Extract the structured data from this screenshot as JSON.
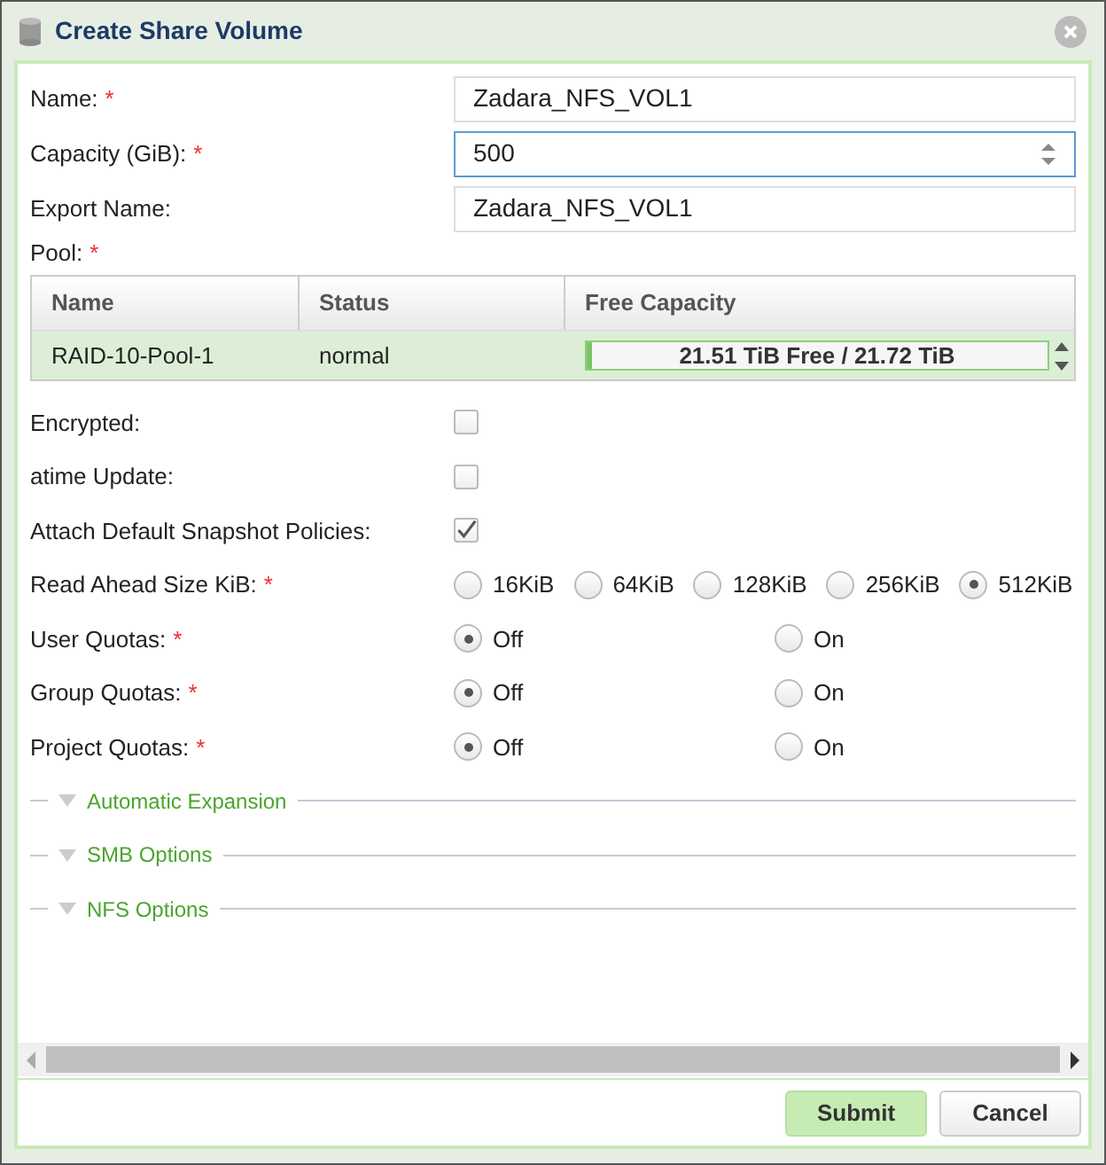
{
  "window": {
    "title": "Create Share Volume"
  },
  "fields": [
    {
      "label": "Name:",
      "required_mark": "*",
      "value": "Zadara_NFS_VOL1",
      "kind": "text",
      "focused": false
    },
    {
      "label": "Capacity (GiB):",
      "required_mark": "*",
      "value": "500",
      "kind": "number",
      "focused": true
    },
    {
      "label": "Export Name:",
      "value": "Zadara_NFS_VOL1",
      "kind": "text",
      "focused": false
    }
  ],
  "pool": {
    "label": "Pool:",
    "required_mark": "*",
    "columns": [
      "Name",
      "Status",
      "Free Capacity"
    ],
    "rows": [
      {
        "name": "RAID-10-Pool-1",
        "status": "normal",
        "free": "21.51 TiB Free / 21.72 TiB",
        "level": 0.01,
        "selected": true
      }
    ]
  },
  "checkboxes": [
    {
      "label": "Encrypted:",
      "checked": false
    },
    {
      "label": "atime Update:",
      "checked": false
    },
    {
      "label": "Attach Default Snapshot Policies:",
      "checked": true
    }
  ],
  "radio_groups": [
    {
      "label": "Read Ahead Size KiB:",
      "required_mark": "*",
      "kind": "compact",
      "options": [
        {
          "label": "16KiB",
          "selected": false
        },
        {
          "label": "64KiB",
          "selected": false
        },
        {
          "label": "128KiB",
          "selected": false
        },
        {
          "label": "256KiB",
          "selected": false
        },
        {
          "label": "512KiB",
          "selected": true
        }
      ]
    },
    {
      "label": "User Quotas:",
      "required_mark": "*",
      "kind": "wide",
      "options": [
        {
          "label": "Off",
          "selected": true
        },
        {
          "label": "On",
          "selected": false
        }
      ]
    },
    {
      "label": "Group Quotas:",
      "required_mark": "*",
      "kind": "wide",
      "options": [
        {
          "label": "Off",
          "selected": true
        },
        {
          "label": "On",
          "selected": false
        }
      ]
    },
    {
      "label": "Project Quotas:",
      "required_mark": "*",
      "kind": "wide",
      "options": [
        {
          "label": "Off",
          "selected": true
        },
        {
          "label": "On",
          "selected": false
        }
      ]
    }
  ],
  "sections": [
    {
      "label": "Automatic Expansion",
      "expanded": false
    },
    {
      "label": "SMB Options",
      "expanded": false
    },
    {
      "label": "NFS Options",
      "expanded": false
    }
  ],
  "buttons": [
    {
      "label": "Submit",
      "kind": "primary"
    },
    {
      "label": "Cancel",
      "kind": "secondary"
    }
  ]
}
